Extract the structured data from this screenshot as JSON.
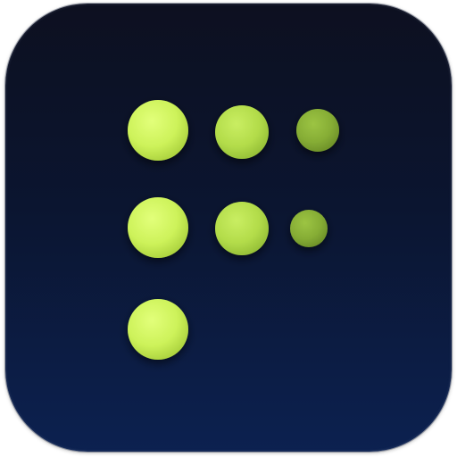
{
  "icon": {
    "name": "dot-grid-f-logo",
    "background_top": "#0d1020",
    "background_bottom": "#0c2150",
    "dot_colors": {
      "large": "#cdf25a",
      "medium": "#b3dc4a",
      "small": "#86ad35"
    },
    "rows": [
      [
        "large",
        "medium",
        "small"
      ],
      [
        "large",
        "medium",
        "small"
      ],
      [
        "large"
      ]
    ]
  }
}
